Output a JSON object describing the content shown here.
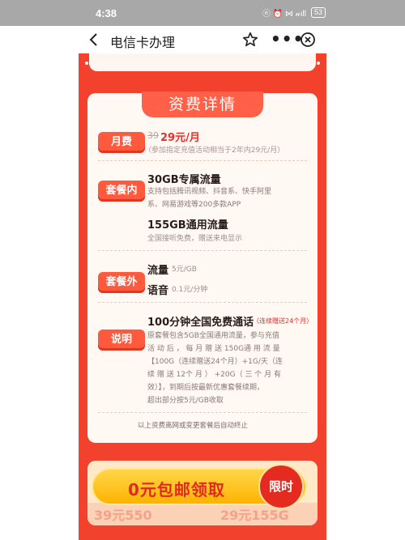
{
  "status_bar": {
    "time": "4:38",
    "signal_text": "ⓝ ⏰ ⋈ 𝓃ıll",
    "battery": "53"
  },
  "nav": {
    "title": "电信卡办理",
    "more": "•••"
  },
  "card": {
    "title": "资费详情",
    "monthly": {
      "tag": "月费",
      "old_price": "39",
      "price": "29元/月",
      "note": "（参加指定充值活动相当于2年内29元/月）"
    },
    "package_in": {
      "tag": "套餐内",
      "item1_title": "30GB专属流量",
      "item1_desc_line1": "支持包括腾讯视频、抖音系、快手阿里",
      "item1_desc_line2": "系、网易游戏等200多款APP",
      "item2_title": "155GB通用流量",
      "item2_desc": "全国接听免费，赠送来电显示"
    },
    "package_out": {
      "tag": "套餐外",
      "flow_label": "流量",
      "flow_value": "5元/GB",
      "voice_label": "语音",
      "voice_value": "0.1元/分钟"
    },
    "explain": {
      "tag": "说明",
      "title": "100分钟全国免费通话",
      "badge": "（连续赠送24个月）",
      "lines": [
        "原套餐包含5GB全国通用流量，参与充值",
        "活 动 后 ， 每 月 赠 送 150G通 用 流 量",
        "【100G（连续赠送24个月）+1G/天（连",
        "续 赠 送 12个 月 ） +20G（ 三 个 月 有",
        "效）】，到期后按最新优惠套餐续期，",
        "超出部分按5元/GB收取"
      ]
    },
    "footer": "以上资费离网或变更套餐后自动终止"
  },
  "cta": {
    "label": "0元包邮领取",
    "badge": "限时",
    "bottom_left": "39元550",
    "bottom_right": "29元155G"
  }
}
